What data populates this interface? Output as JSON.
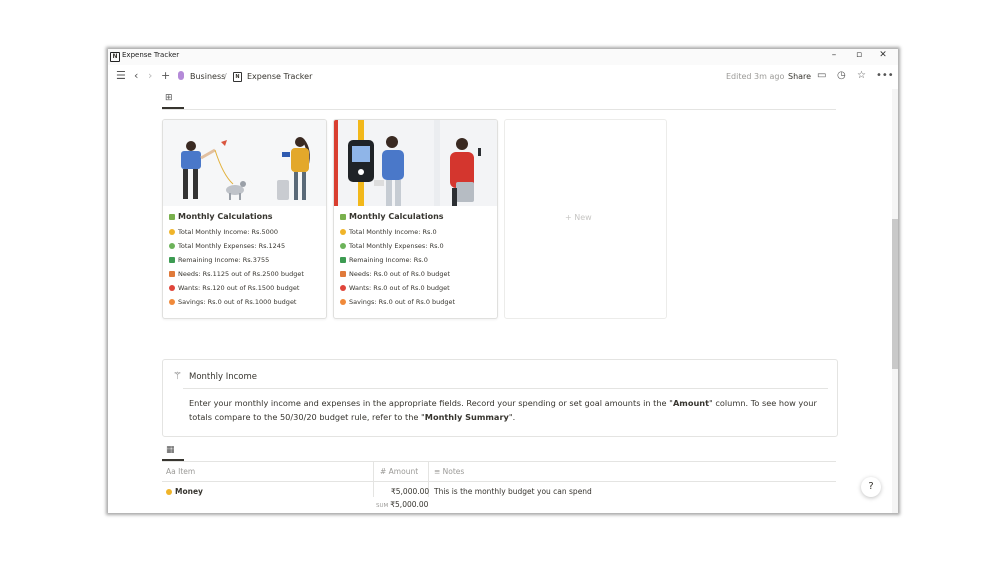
{
  "window": {
    "title": "Expense Tracker"
  },
  "topbar": {
    "breadcrumb_workspace": "Business",
    "breadcrumb_separator": "/",
    "breadcrumb_page": "Expense Tracker",
    "edited": "Edited 3m ago",
    "share": "Share"
  },
  "gallery": {
    "cards": [
      {
        "title": "Monthly Calculations",
        "lines": [
          "Total Monthly Income: Rs.5000",
          "Total Monthly Expenses: Rs.1245",
          "Remaining Income: Rs.3755",
          "Needs: Rs.1125 out of Rs.2500 budget",
          "Wants: Rs.120 out of Rs.1500 budget",
          "Savings: Rs.0 out of Rs.1000 budget"
        ]
      },
      {
        "title": "Monthly Calculations",
        "lines": [
          "Total Monthly Income: Rs.0",
          "Total Monthly Expenses: Rs.0",
          "Remaining Income: Rs.0",
          "Needs: Rs.0 out of Rs.0 budget",
          "Wants: Rs.0 out of Rs.0 budget",
          "Savings: Rs.0 out of Rs.0 budget"
        ]
      }
    ],
    "new_label": "+ New"
  },
  "callout": {
    "title": "Monthly Income",
    "body_1": "Enter your monthly income and expenses in the appropriate fields. Record your spending or set goal amounts in the \"",
    "body_bold_1": "Amount",
    "body_2": "\" column. To see how your totals compare to the 50/30/20 budget rule, refer to the \"",
    "body_bold_2": "Monthly Summary",
    "body_3": "\"."
  },
  "table": {
    "columns": {
      "item": "Aa Item",
      "amount": "# Amount",
      "notes": "≡ Notes"
    },
    "rows": [
      {
        "item": "Money",
        "amount": "₹5,000.00",
        "notes": "This is the monthly budget you can spend"
      }
    ],
    "sum_label": "SUM",
    "sum_value": "₹5,000.00"
  },
  "help": "?",
  "colors": {
    "accent_dark": "#37352f",
    "muted": "#9b9a97",
    "border": "#e4e4e2"
  }
}
